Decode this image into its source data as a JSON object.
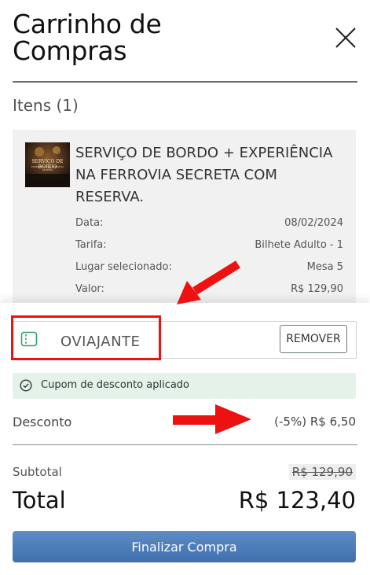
{
  "header": {
    "title_line1": "Carrinho de",
    "title_line2": "Compras"
  },
  "items": {
    "label": "Itens (1)",
    "product": {
      "thumb_text_line1": "SERVIÇO DE BORDO",
      "thumb_text_line2": "EXPERIÊNCIA NA FERROVIA SECRETA",
      "name": "SERVIÇO DE BORDO + EXPERIÊNCIA NA FERROVIA SECRETA COM RESERVA.",
      "details": [
        {
          "label": "Data:",
          "value": "08/02/2024"
        },
        {
          "label": "Tarifa:",
          "value": "Bilhete Adulto - 1"
        },
        {
          "label": "Lugar selecionado:",
          "value": "Mesa 5"
        },
        {
          "label": "Valor:",
          "value": "R$ 129,90"
        }
      ]
    }
  },
  "coupon": {
    "code": "OVIAJANTE",
    "remove_label": "REMOVER",
    "success_message": "Cupom de desconto aplicado"
  },
  "summary": {
    "discount_label": "Desconto",
    "discount_value": "(-5%) R$ 6,50",
    "subtotal_label": "Subtotal",
    "subtotal_value": "R$ 129,90",
    "total_label": "Total",
    "total_value": "R$ 123,40"
  },
  "checkout_label": "Finalizar Compra",
  "icons": {
    "close": "close-icon",
    "ticket": "ticket-icon",
    "check": "check-circle-icon"
  },
  "colors": {
    "annotation_red": "#e11111",
    "checkout_blue": "#4a7bb9",
    "success_bg": "#e4f2ea",
    "success_green": "#2e7d4f"
  }
}
